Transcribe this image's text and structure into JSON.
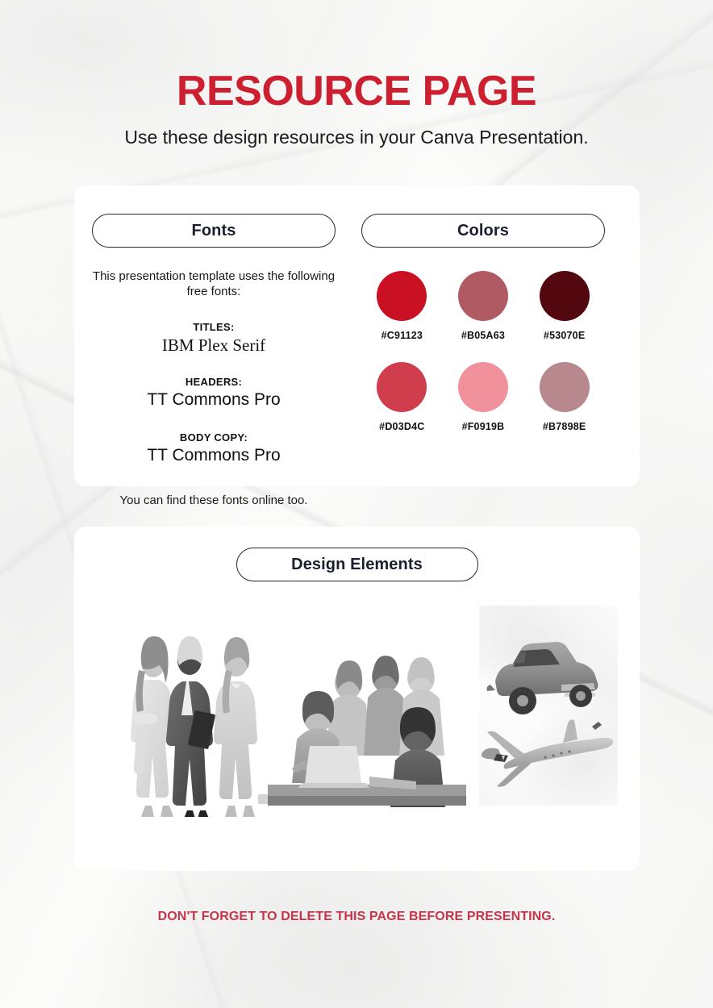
{
  "header": {
    "title": "RESOURCE PAGE",
    "subtitle": "Use these design resources in your Canva Presentation.",
    "title_color": "#CC2030"
  },
  "fonts_panel": {
    "pill_label": "Fonts",
    "intro": "This presentation template uses the following free fonts:",
    "entries": [
      {
        "label": "TITLES:",
        "name": "IBM Plex Serif"
      },
      {
        "label": "HEADERS:",
        "name": "TT Commons Pro"
      },
      {
        "label": "BODY COPY:",
        "name": "TT Commons Pro"
      }
    ],
    "footnote": "You can find these fonts online too."
  },
  "colors_panel": {
    "pill_label": "Colors",
    "swatches": [
      {
        "hex": "#C91123",
        "label": "#C91123"
      },
      {
        "hex": "#B05A63",
        "label": "#B05A63"
      },
      {
        "hex": "#53070E",
        "label": "#53070E"
      },
      {
        "hex": "#D03D4C",
        "label": "#D03D4C"
      },
      {
        "hex": "#F0919B",
        "label": "#F0919B"
      },
      {
        "hex": "#B7898E",
        "label": "#B7898E"
      }
    ]
  },
  "design_panel": {
    "pill_label": "Design Elements",
    "images": [
      {
        "name": "three-people-walking-photo"
      },
      {
        "name": "team-around-laptop-photo"
      },
      {
        "name": "vintage-car-and-airplane-photo"
      }
    ]
  },
  "footer": {
    "note": "DON'T FORGET TO DELETE THIS PAGE BEFORE PRESENTING.",
    "note_color": "#C8344A"
  }
}
